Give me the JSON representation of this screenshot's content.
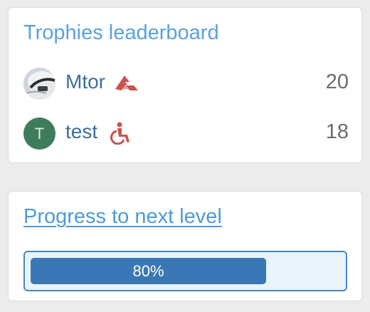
{
  "leaderboard": {
    "title": "Trophies leaderboard",
    "entries": [
      {
        "name": "Mtor",
        "score": "20",
        "avatar": "user-photo",
        "badge_icon": "rank-chevron-icon",
        "badge_color": "#c9534f"
      },
      {
        "name": "test",
        "score": "18",
        "avatar_letter": "T",
        "avatar_color": "#3f7d5a",
        "badge_icon": "wheelchair-icon",
        "badge_color": "#c9534f"
      }
    ]
  },
  "progress": {
    "title": "Progress to next level",
    "percent": 80,
    "label": "80%"
  },
  "colors": {
    "title_blue": "#5aa2dd",
    "name_blue": "#3b6f9a",
    "bar_blue": "#3a78b5",
    "track_border": "#4a86bf",
    "track_bg": "#eaf4fc",
    "score_gray": "#6c6c6c"
  }
}
